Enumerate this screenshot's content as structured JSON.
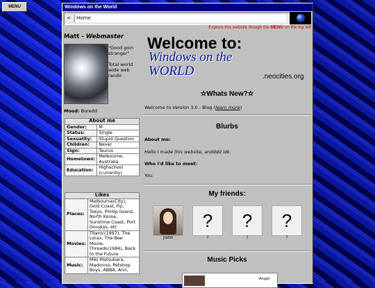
{
  "menu_label": "MENU",
  "window_title": "Windows on the World",
  "nav": {
    "back": "<",
    "address": "Home"
  },
  "explore": {
    "pre": "Explore this website though the ",
    "menu": "MENU",
    "post": " on the top left"
  },
  "profile": {
    "name": "Matt",
    "role": "Webmaster",
    "quote_1": "\"Good goin stranger\"",
    "quote_2": "Total world wide web rando",
    "mood_label": "Mood:",
    "mood_value": "Boredd"
  },
  "hero": {
    "welcome": "Welcome to:",
    "line1": "Windows on the",
    "line2": "WORLD",
    "site": ".neocities.org"
  },
  "whats_new": {
    "title": "✫Whats New?✫",
    "text": "Welcome to Version 3.0 - Blog (",
    "link": "learn more",
    "close": ")"
  },
  "about": {
    "title": "About me",
    "rows": [
      {
        "k": "Gender:",
        "v": "M"
      },
      {
        "k": "Status:",
        "v": "Single"
      },
      {
        "k": "Sexuality:",
        "v": "Stupid Question"
      },
      {
        "k": "Children:",
        "v": "Never"
      },
      {
        "k": "Sign:",
        "v": "Taurus"
      },
      {
        "k": "Hometown:",
        "v": "Melbourne, Australia"
      },
      {
        "k": "Education:",
        "v": "Highschool (currently)"
      }
    ]
  },
  "likes": {
    "title": "Likes",
    "rows": [
      {
        "k": "Places:",
        "v": "Melbourne(City), Gold Coast, Fiji, Tokyo, Phillip Island, North Korea, Sunshine Coast, Port Douglas, etc"
      },
      {
        "k": "Movies:",
        "v": "Titanic(1997), The Lorax, The Bee Movie, Threads(1984), Back to the Future"
      },
      {
        "k": "Music:",
        "v": "Miki Matsubara, Madonna, Petshop Boys, ABBA, Anri,"
      }
    ]
  },
  "blurbs": {
    "title": "Blurbs",
    "about_label": "About me:",
    "about_text": "Hello I made this website, andddd idk.",
    "meet_label": "Who I'd like to meet:",
    "meet_text": "You."
  },
  "friends": {
    "title": "My friends:",
    "items": [
      {
        "name": "Jiafei",
        "pic": ""
      },
      {
        "name": "?",
        "pic": "?"
      },
      {
        "name": "?",
        "pic": "?"
      },
      {
        "name": "?",
        "pic": "?"
      }
    ]
  },
  "music": {
    "title": "Music Picks",
    "track": "Angel"
  }
}
